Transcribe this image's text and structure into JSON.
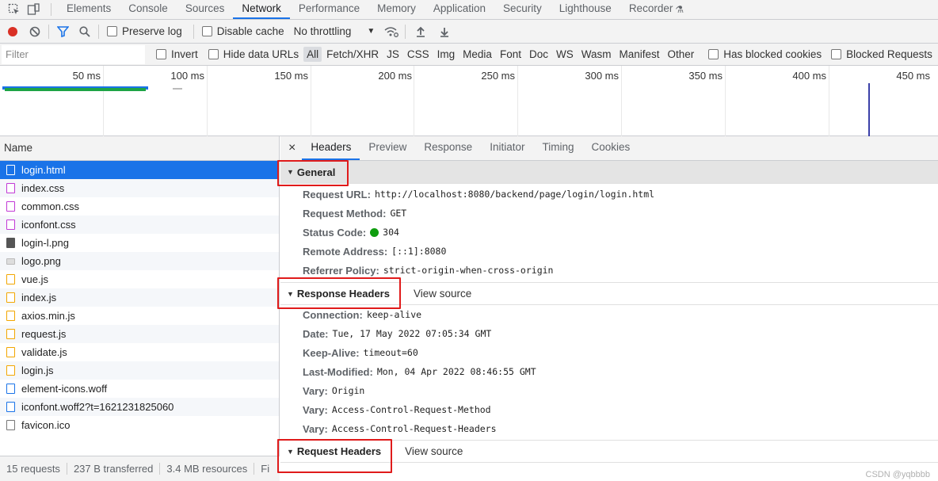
{
  "devtools_tabs": [
    "Elements",
    "Console",
    "Sources",
    "Network",
    "Performance",
    "Memory",
    "Application",
    "Security",
    "Lighthouse",
    "Recorder"
  ],
  "active_tab": "Network",
  "toolbar": {
    "preserve_log": "Preserve log",
    "disable_cache": "Disable cache",
    "throttling": "No throttling"
  },
  "filterbar": {
    "placeholder": "Filter",
    "invert": "Invert",
    "hide_data_urls": "Hide data URLs",
    "types": [
      "All",
      "Fetch/XHR",
      "JS",
      "CSS",
      "Img",
      "Media",
      "Font",
      "Doc",
      "WS",
      "Wasm",
      "Manifest",
      "Other"
    ],
    "selected_type": "All",
    "blocked_cookies": "Has blocked cookies",
    "blocked_requests": "Blocked Requests"
  },
  "timeline": {
    "labels": [
      "50 ms",
      "100 ms",
      "150 ms",
      "200 ms",
      "250 ms",
      "300 ms",
      "350 ms",
      "400 ms",
      "450 ms"
    ]
  },
  "requests": {
    "header": "Name",
    "items": [
      {
        "name": "login.html",
        "type": "doc",
        "selected": true
      },
      {
        "name": "index.css",
        "type": "css"
      },
      {
        "name": "common.css",
        "type": "css"
      },
      {
        "name": "iconfont.css",
        "type": "css"
      },
      {
        "name": "login-l.png",
        "type": "img"
      },
      {
        "name": "logo.png",
        "type": "logo"
      },
      {
        "name": "vue.js",
        "type": "js"
      },
      {
        "name": "index.js",
        "type": "js"
      },
      {
        "name": "axios.min.js",
        "type": "js"
      },
      {
        "name": "request.js",
        "type": "js"
      },
      {
        "name": "validate.js",
        "type": "js"
      },
      {
        "name": "login.js",
        "type": "js"
      },
      {
        "name": "element-icons.woff",
        "type": "font"
      },
      {
        "name": "iconfont.woff2?t=1621231825060",
        "type": "font"
      },
      {
        "name": "favicon.ico",
        "type": "other"
      }
    ]
  },
  "status": {
    "requests": "15 requests",
    "transferred": "237 B transferred",
    "resources": "3.4 MB resources",
    "finish": "Fi"
  },
  "detail_tabs": [
    "Headers",
    "Preview",
    "Response",
    "Initiator",
    "Timing",
    "Cookies"
  ],
  "detail_active": "Headers",
  "close_glyph": "×",
  "general": {
    "title": "General",
    "rows": [
      {
        "key": "Request URL:",
        "value": "http://localhost:8080/backend/page/login/login.html"
      },
      {
        "key": "Request Method:",
        "value": "GET"
      },
      {
        "key": "Status Code:",
        "value": "304",
        "status_color": "#0f9d0f"
      },
      {
        "key": "Remote Address:",
        "value": "[::1]:8080"
      },
      {
        "key": "Referrer Policy:",
        "value": "strict-origin-when-cross-origin"
      }
    ]
  },
  "response_headers": {
    "title": "Response Headers",
    "view_source": "View source",
    "rows": [
      {
        "key": "Connection:",
        "value": "keep-alive"
      },
      {
        "key": "Date:",
        "value": "Tue, 17 May 2022 07:05:34 GMT"
      },
      {
        "key": "Keep-Alive:",
        "value": "timeout=60"
      },
      {
        "key": "Last-Modified:",
        "value": "Mon, 04 Apr 2022 08:46:55 GMT"
      },
      {
        "key": "Vary:",
        "value": "Origin"
      },
      {
        "key": "Vary:",
        "value": "Access-Control-Request-Method"
      },
      {
        "key": "Vary:",
        "value": "Access-Control-Request-Headers"
      }
    ]
  },
  "request_headers": {
    "title": "Request Headers",
    "view_source": "View source"
  },
  "watermark": "CSDN @yqbbbb",
  "colors": {
    "accent": "#1a73e8",
    "highlight_box": "#e01b1b"
  }
}
